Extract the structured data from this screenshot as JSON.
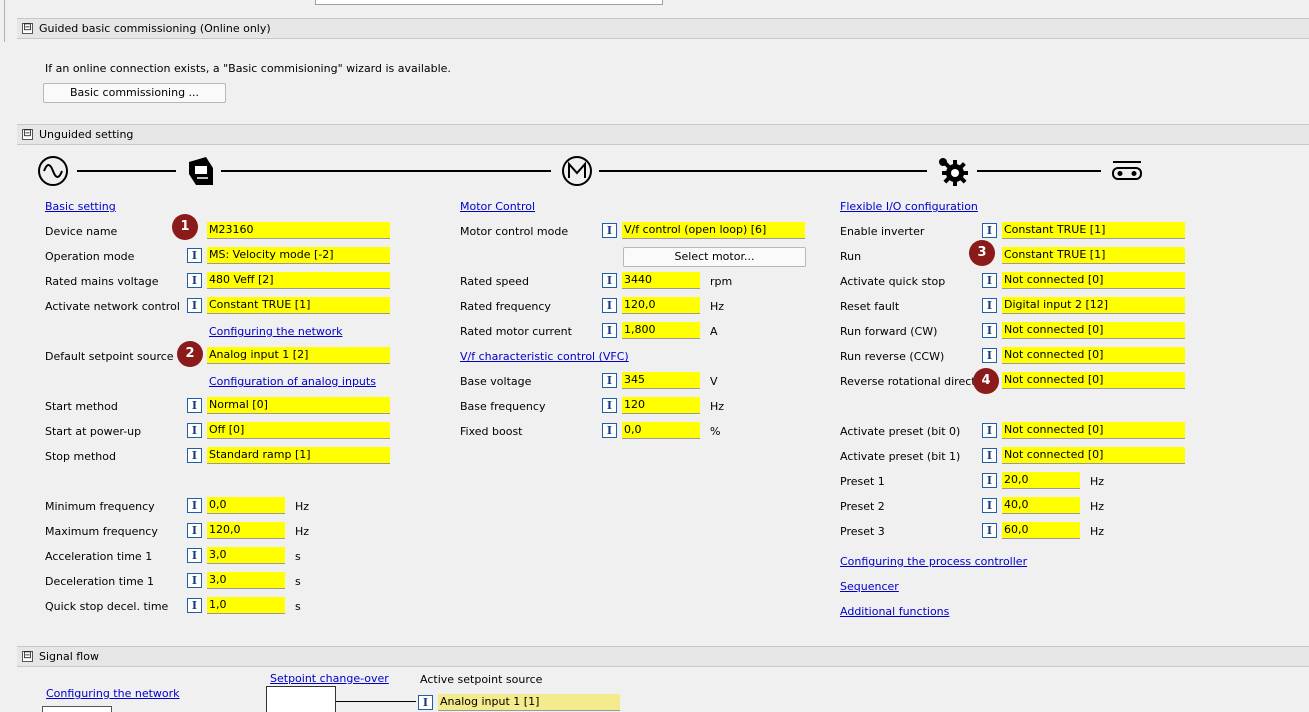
{
  "guided": {
    "title": "Guided basic commissioning (Online only)",
    "info": "If an online connection exists, a \"Basic commisioning\" wizard is available.",
    "button": "Basic commissioning ..."
  },
  "unguided": {
    "title": "Unguided setting"
  },
  "signal": {
    "title": "Signal flow",
    "configure_network": "Configuring the network",
    "setpoint_changeover": "Setpoint change-over",
    "active_source_label": "Active setpoint source",
    "active_source_value": "Analog input 1 [1]"
  },
  "toggle_symbol": "⊟",
  "info_icon_symbol": "I",
  "icons": [
    "ac-mains-icon",
    "inverter-icon",
    "motor-icon",
    "gear-icon",
    "conveyor-icon"
  ],
  "col1": {
    "heading": "Basic setting",
    "device_name": {
      "label": "Device name",
      "value": "M23160",
      "badge": "1"
    },
    "operation_mode": {
      "label": "Operation mode",
      "value": "MS: Velocity mode [-2]"
    },
    "rated_mains": {
      "label": "Rated mains voltage",
      "value": "480 Veff [2]"
    },
    "network_control": {
      "label": "Activate network control",
      "value": "Constant TRUE [1]"
    },
    "link_network": "Configuring the network",
    "default_setpoint": {
      "label": "Default setpoint source",
      "value": "Analog input 1 [2]",
      "badge": "2"
    },
    "link_analog": "Configuration of analog inputs",
    "start_method": {
      "label": "Start method",
      "value": "Normal [0]"
    },
    "start_powerup": {
      "label": "Start at power-up",
      "value": "Off [0]"
    },
    "stop_method": {
      "label": "Stop method",
      "value": "Standard ramp [1]"
    },
    "min_freq": {
      "label": "Minimum frequency",
      "value": "0,0",
      "unit": "Hz"
    },
    "max_freq": {
      "label": "Maximum frequency",
      "value": "120,0",
      "unit": "Hz"
    },
    "accel": {
      "label": "Acceleration time 1",
      "value": "3,0",
      "unit": "s"
    },
    "decel": {
      "label": "Deceleration time 1",
      "value": "3,0",
      "unit": "s"
    },
    "quickstop": {
      "label": "Quick stop decel. time",
      "value": "1,0",
      "unit": "s"
    }
  },
  "col2": {
    "heading": "Motor Control",
    "control_mode": {
      "label": "Motor control mode",
      "value": "V/f control (open loop) [6]"
    },
    "select_motor": "Select motor...",
    "rated_speed": {
      "label": "Rated speed",
      "value": "3440",
      "unit": "rpm"
    },
    "rated_freq": {
      "label": "Rated frequency",
      "value": "120,0",
      "unit": "Hz"
    },
    "rated_current": {
      "label": "Rated motor current",
      "value": "1,800",
      "unit": "A"
    },
    "vfc_link": "V/f characteristic control (VFC)",
    "base_voltage": {
      "label": "Base voltage",
      "value": "345",
      "unit": "V"
    },
    "base_freq": {
      "label": "Base frequency",
      "value": "120",
      "unit": "Hz"
    },
    "fixed_boost": {
      "label": "Fixed boost",
      "value": "0,0",
      "unit": "%"
    }
  },
  "col3": {
    "heading": "Flexible I/O configuration",
    "enable_inverter": {
      "label": "Enable inverter",
      "value": "Constant TRUE [1]"
    },
    "run": {
      "label": "Run",
      "value": "Constant TRUE [1]",
      "badge": "3"
    },
    "quick_stop": {
      "label": "Activate quick stop",
      "value": "Not connected [0]"
    },
    "reset_fault": {
      "label": "Reset fault",
      "value": "Digital input 2 [12]"
    },
    "run_fwd": {
      "label": "Run forward (CW)",
      "value": "Not connected [0]"
    },
    "run_rev": {
      "label": "Run reverse (CCW)",
      "value": "Not connected [0]"
    },
    "reverse_dir": {
      "label": "Reverse rotational direct.",
      "value": "Not connected [0]",
      "badge": "4"
    },
    "preset0": {
      "label": "Activate preset (bit 0)",
      "value": "Not connected [0]"
    },
    "preset1": {
      "label": "Activate preset (bit 1)",
      "value": "Not connected [0]"
    },
    "p1": {
      "label": "Preset 1",
      "value": "20,0",
      "unit": "Hz"
    },
    "p2": {
      "label": "Preset 2",
      "value": "40,0",
      "unit": "Hz"
    },
    "p3": {
      "label": "Preset 3",
      "value": "60,0",
      "unit": "Hz"
    },
    "link_process": "Configuring the process controller",
    "link_sequencer": "Sequencer",
    "link_additional": "Additional functions"
  }
}
